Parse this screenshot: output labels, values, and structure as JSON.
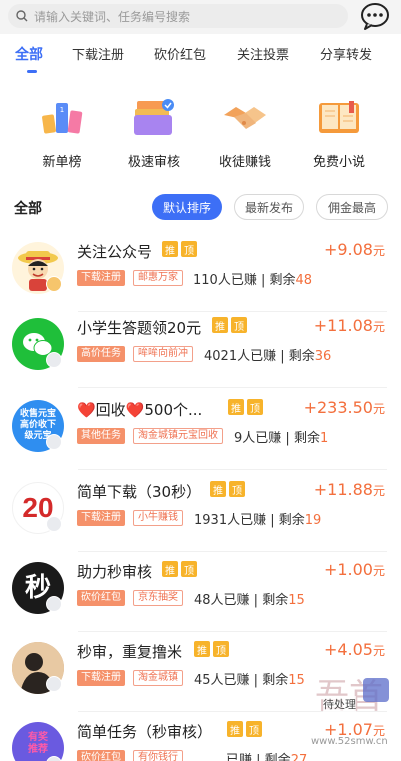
{
  "search": {
    "placeholder": "请输入关键词、任务编号搜索"
  },
  "tabs": [
    "全部",
    "下载注册",
    "砍价红包",
    "关注投票",
    "分享转发"
  ],
  "quick": [
    {
      "label": "新单榜",
      "icon": "leaderboard-icon"
    },
    {
      "label": "极速审核",
      "icon": "fast-review-icon"
    },
    {
      "label": "收徒赚钱",
      "icon": "handshake-icon"
    },
    {
      "label": "免费小说",
      "icon": "book-icon"
    }
  ],
  "section": {
    "title": "全部"
  },
  "filters": [
    "默认排序",
    "最新发布",
    "佣金最高"
  ],
  "marks": {
    "recommend": "推",
    "top": "顶"
  },
  "tasks": [
    {
      "title": "关注公众号",
      "price": "+9.08",
      "unit": "元",
      "tag1": "下载注册",
      "tag2": "邮惠万家",
      "earned": "110人已赚",
      "sep": " | ",
      "remain_label": "剩余",
      "remain": "48"
    },
    {
      "title": "小学生答题领20元",
      "price": "+11.08",
      "unit": "元",
      "tag1": "高价任务",
      "tag2": "哞哞向前冲",
      "earned": "4021人已赚",
      "sep": " | ",
      "remain_label": "剩余",
      "remain": "36"
    },
    {
      "title": "❤️回收❤️500个...",
      "price": "+233.50",
      "unit": "元",
      "tag1": "其他任务",
      "tag2": "淘金城镇元宝回收",
      "earned": "9人已赚",
      "sep": " | ",
      "remain_label": "剩余",
      "remain": "1",
      "avatar_text": [
        "收售元宝",
        "高价收下",
        "级元宝"
      ]
    },
    {
      "title": "简单下载（30秒）",
      "price": "+11.88",
      "unit": "元",
      "tag1": "下载注册",
      "tag2": "小牛赚钱",
      "earned": "1931人已赚",
      "sep": " | ",
      "remain_label": "剩余",
      "remain": "19",
      "avatar_text": [
        "20"
      ]
    },
    {
      "title": "助力秒审核",
      "price": "+1.00",
      "unit": "元",
      "tag1": "砍价红包",
      "tag2": "京东抽奖",
      "earned": "48人已赚",
      "sep": " | ",
      "remain_label": "剩余",
      "remain": "15",
      "avatar_text": [
        "秒"
      ]
    },
    {
      "title": "秒审，重复撸米",
      "price": "+4.05",
      "unit": "元",
      "tag1": "下载注册",
      "tag2": "淘金城镇",
      "earned": "45人已赚",
      "sep": " | ",
      "remain_label": "剩余",
      "remain": "15"
    },
    {
      "title": "简单任务（秒审核）",
      "price": "+1.07",
      "unit": "元",
      "tag1": "砍价红包",
      "tag2": "有你钱行",
      "earned": "已赚",
      "sep": " | ",
      "remain_label": "剩余",
      "remain": "27",
      "avatar_text": [
        "有奖",
        "推荐"
      ]
    }
  ],
  "watermark": {
    "text": "www.52smw.cn",
    "label": "待处理",
    "glyph": "吾首"
  },
  "colors": {
    "accent": "#3d6ff6",
    "price": "#f36f3d",
    "mark": "#f7b32b",
    "tag": "#f5916a"
  }
}
